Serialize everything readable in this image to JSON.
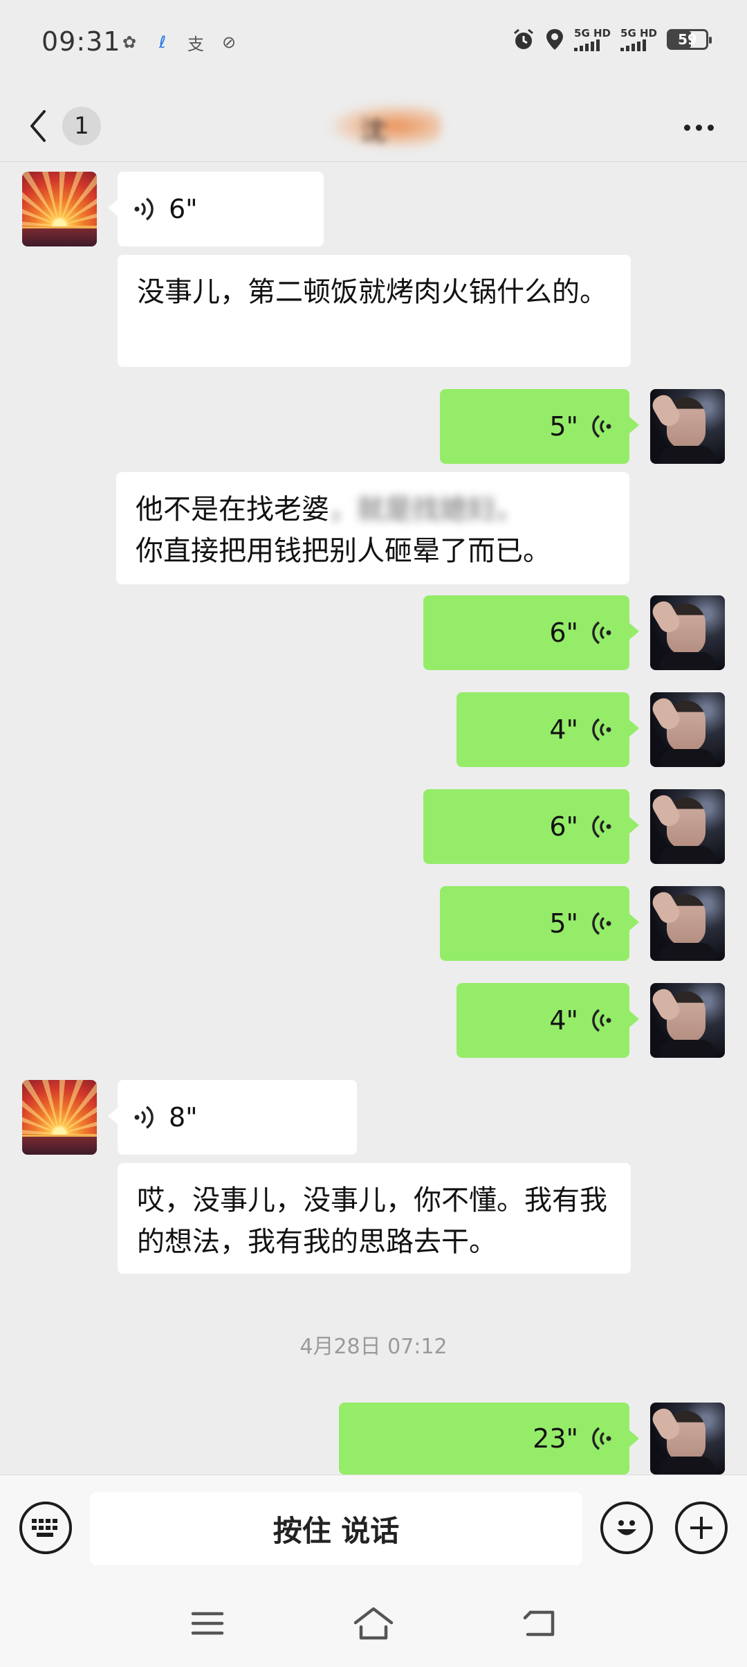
{
  "status_bar": {
    "time": "09:31",
    "app_icons": [
      "app-icon",
      "telecom-icon",
      "alipay-icon",
      "notification-icon"
    ],
    "app_glyphs": [
      "✿",
      "ℓ",
      "支",
      "⊘"
    ],
    "signal_labels": [
      "5G HD",
      "5G HD"
    ],
    "battery": "59",
    "battery_level": 0.59
  },
  "header": {
    "back_badge": "1",
    "title": "沈"
  },
  "messages": {
    "m1_duration": "6\"",
    "m2_text": "没事儿，第二顿饭就烤肉火锅什么的。",
    "m3_duration": "5\"",
    "m4_text_a": "他不是在找老婆",
    "m4_text_blur": "，就是找媳妇，",
    "m4_text_b": "你直接把用钱把别人砸晕了而已。",
    "m5_duration": "6\"",
    "m6_duration": "4\"",
    "m7_duration": "6\"",
    "m8_duration": "5\"",
    "m9_duration": "4\"",
    "m10_duration": "8\"",
    "m11_text": "哎，没事儿，没事儿，你不懂。我有我的想法，我有我的思路去干。",
    "timestamp": "4月28日 07:12",
    "m12_duration": "23\""
  },
  "input_bar": {
    "hold_to_talk": "按住 说话"
  },
  "colors": {
    "sent_bubble": "#95ec69",
    "received_bubble": "#ffffff",
    "background": "#ededed"
  }
}
